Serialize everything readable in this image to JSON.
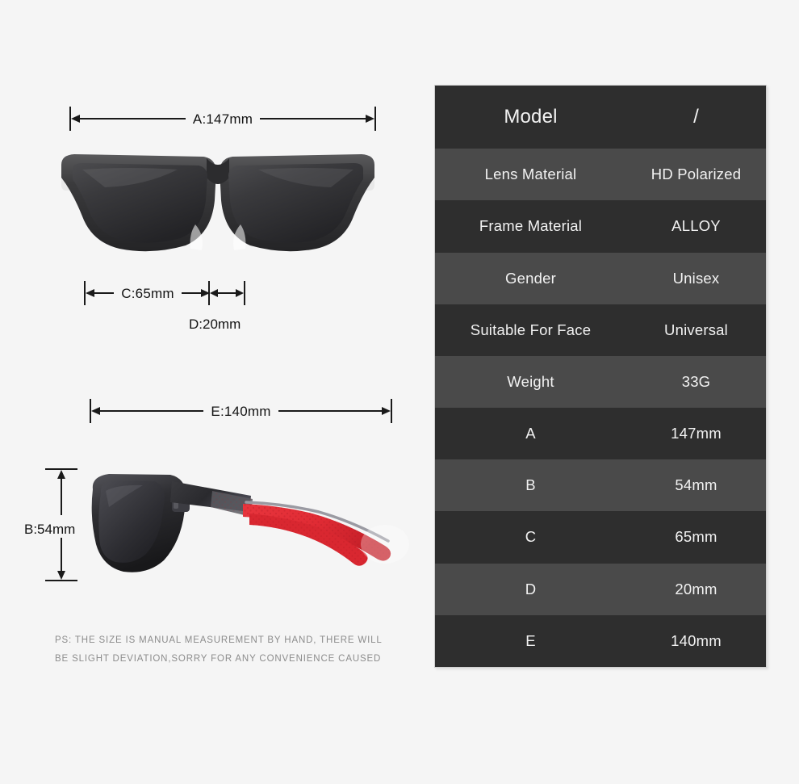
{
  "background_color": "#f5f5f5",
  "left_panel": {
    "dimensions": {
      "a": {
        "label": "A:147mm",
        "letter": "A",
        "value": "147mm"
      },
      "b": {
        "label": "B:54mm",
        "letter": "B",
        "value": "54mm"
      },
      "c": {
        "label": "C:65mm",
        "letter": "C",
        "value": "65mm"
      },
      "d": {
        "label": "D:20mm",
        "letter": "D",
        "value": "20mm"
      },
      "e": {
        "label": "E:140mm",
        "letter": "E",
        "value": "140mm"
      }
    },
    "images": {
      "front_view_alt": "sunglasses-front-view",
      "side_view_alt": "sunglasses-side-view"
    },
    "disclaimer": {
      "line1": "PS: THE SIZE IS MANUAL MEASUREMENT BY HAND, THERE WILL",
      "line2": "BE SLIGHT DEVIATION,SORRY FOR ANY CONVENIENCE CAUSED"
    }
  },
  "spec_table": {
    "row_colors": {
      "dark": "#2e2e2e",
      "light": "#4a4a4a"
    },
    "text_color": "#f2f2f2",
    "rows": [
      {
        "key": "Model",
        "value": "/"
      },
      {
        "key": "Lens Material",
        "value": "HD Polarized"
      },
      {
        "key": "Frame Material",
        "value": "ALLOY"
      },
      {
        "key": "Gender",
        "value": "Unisex"
      },
      {
        "key": "Suitable For Face",
        "value": "Universal"
      },
      {
        "key": "Weight",
        "value": "33G"
      },
      {
        "key": "A",
        "value": "147mm"
      },
      {
        "key": "B",
        "value": "54mm"
      },
      {
        "key": "C",
        "value": "65mm"
      },
      {
        "key": "D",
        "value": "20mm"
      },
      {
        "key": "E",
        "value": "140mm"
      }
    ]
  }
}
